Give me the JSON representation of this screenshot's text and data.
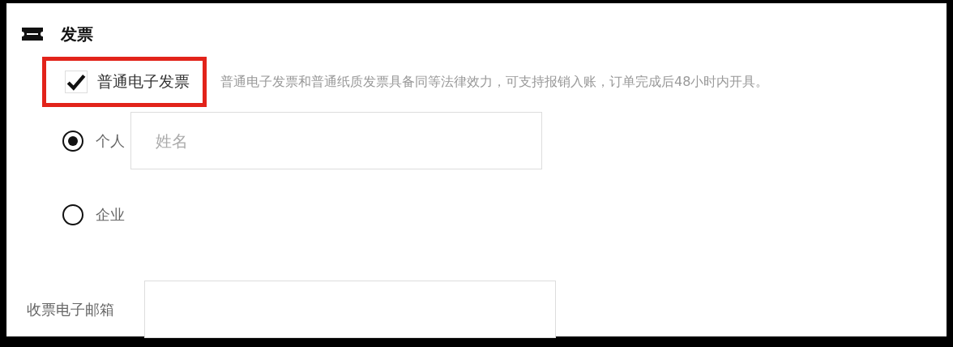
{
  "section": {
    "title": "发票"
  },
  "invoice_option": {
    "label": "普通电子发票",
    "checked": true,
    "highlighted": true,
    "description": "普通电子发票和普通纸质发票具备同等法律效力，可支持报销入账，订单完成后48小时内开具。"
  },
  "recipient_types": [
    {
      "label": "个人",
      "selected": true,
      "name_field": {
        "placeholder": "姓名"
      }
    },
    {
      "label": "企业",
      "selected": false
    }
  ],
  "email": {
    "label": "收票电子邮箱"
  }
}
